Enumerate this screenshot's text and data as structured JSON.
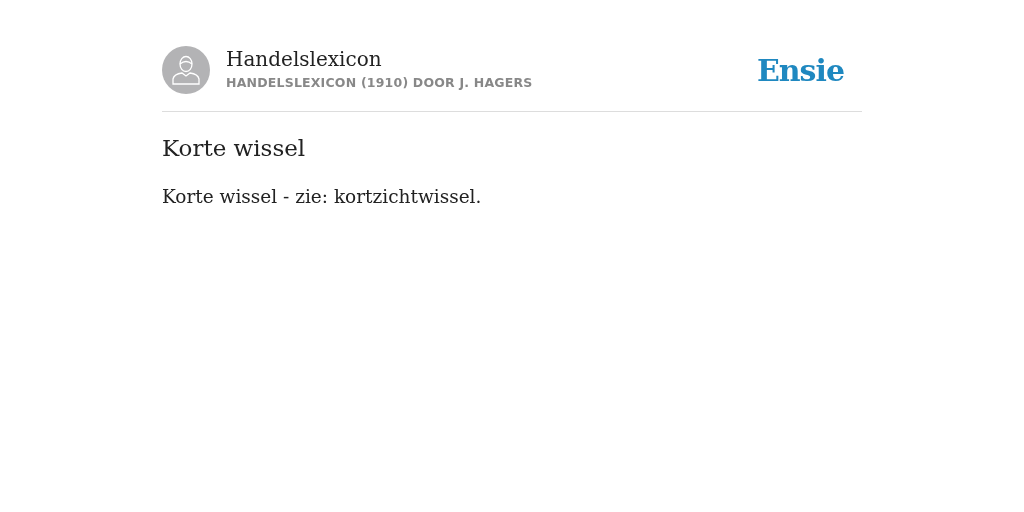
{
  "header": {
    "title": "Handelslexicon",
    "subtitle": "HANDELSLEXICON (1910) DOOR J. HAGERS",
    "logo": "Ensie"
  },
  "article": {
    "heading": "Korte wissel",
    "text": "Korte wissel - zie: kortzichtwissel."
  }
}
